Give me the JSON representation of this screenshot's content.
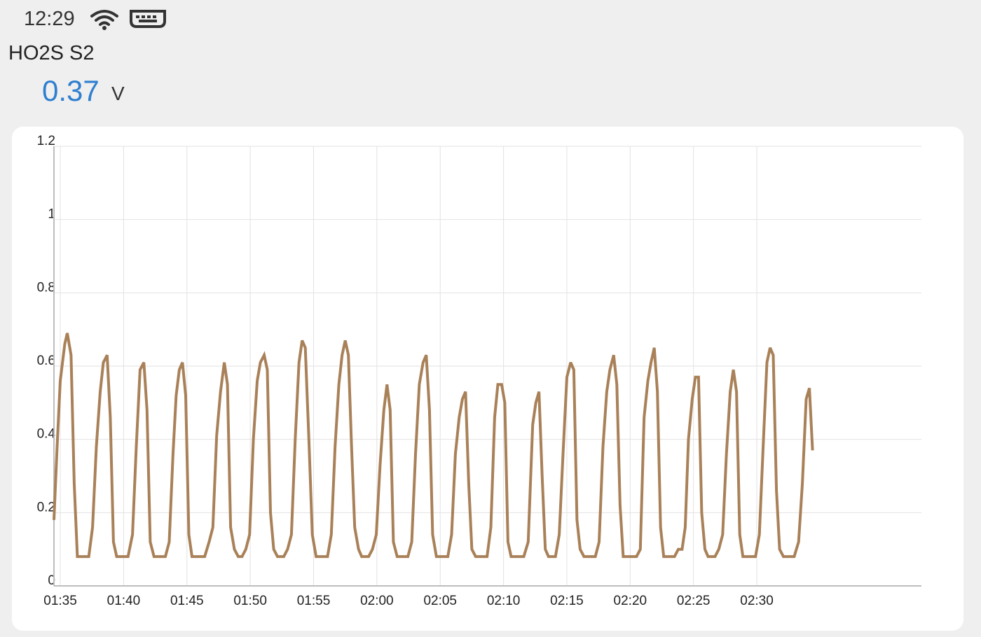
{
  "status_bar": {
    "time": "12:29",
    "icons": [
      "wifi-icon",
      "keyboard-icon"
    ]
  },
  "sensor": {
    "name": "HO2S S2",
    "value": "0.37",
    "unit": "V"
  },
  "colors": {
    "value": "#2f7fd0",
    "line": "#a98159",
    "grid": "#e2e2e2",
    "axis": "#bdbdbd",
    "card": "#ffffff",
    "background": "#efefef"
  },
  "chart_data": {
    "type": "line",
    "title": "",
    "xlabel": "",
    "ylabel": "",
    "ylim": [
      0,
      1.2
    ],
    "xlim": [
      0,
      137
    ],
    "grid": true,
    "y_ticks": [
      {
        "value": 0,
        "label": "0"
      },
      {
        "value": 0.2,
        "label": "0.2"
      },
      {
        "value": 0.4,
        "label": "0.4"
      },
      {
        "value": 0.6,
        "label": "0.6"
      },
      {
        "value": 0.8,
        "label": "0.8"
      },
      {
        "value": 1.0,
        "label": "1"
      },
      {
        "value": 1.2,
        "label": "1.2"
      }
    ],
    "x_ticks": [
      {
        "value": 1,
        "label": "01:35"
      },
      {
        "value": 11,
        "label": "01:40"
      },
      {
        "value": 21,
        "label": "01:45"
      },
      {
        "value": 31,
        "label": "01:50"
      },
      {
        "value": 41,
        "label": "01:55"
      },
      {
        "value": 51,
        "label": "02:00"
      },
      {
        "value": 61,
        "label": "02:05"
      },
      {
        "value": 71,
        "label": "02:10"
      },
      {
        "value": 81,
        "label": "02:15"
      },
      {
        "value": 91,
        "label": "02:20"
      },
      {
        "value": 101,
        "label": "02:25"
      },
      {
        "value": 111,
        "label": "02:30"
      }
    ],
    "series": [
      {
        "values": [
          [
            0,
            0.18
          ],
          [
            0.5,
            0.38
          ],
          [
            1,
            0.56
          ],
          [
            1.7,
            0.66
          ],
          [
            2.1,
            0.69
          ],
          [
            2.7,
            0.63
          ],
          [
            3.2,
            0.28
          ],
          [
            3.7,
            0.08
          ],
          [
            5.5,
            0.08
          ],
          [
            6.1,
            0.16
          ],
          [
            6.7,
            0.38
          ],
          [
            7.3,
            0.53
          ],
          [
            7.8,
            0.61
          ],
          [
            8.4,
            0.63
          ],
          [
            8.9,
            0.46
          ],
          [
            9.4,
            0.12
          ],
          [
            9.9,
            0.08
          ],
          [
            11.7,
            0.08
          ],
          [
            12.4,
            0.14
          ],
          [
            13.0,
            0.38
          ],
          [
            13.6,
            0.59
          ],
          [
            14.2,
            0.61
          ],
          [
            14.7,
            0.48
          ],
          [
            15.2,
            0.12
          ],
          [
            15.8,
            0.08
          ],
          [
            17.6,
            0.08
          ],
          [
            18.2,
            0.12
          ],
          [
            18.8,
            0.36
          ],
          [
            19.3,
            0.52
          ],
          [
            19.8,
            0.59
          ],
          [
            20.3,
            0.61
          ],
          [
            20.8,
            0.52
          ],
          [
            21.3,
            0.14
          ],
          [
            21.8,
            0.08
          ],
          [
            23.8,
            0.08
          ],
          [
            24.5,
            0.12
          ],
          [
            25.1,
            0.16
          ],
          [
            25.7,
            0.41
          ],
          [
            26.3,
            0.53
          ],
          [
            26.9,
            0.61
          ],
          [
            27.4,
            0.55
          ],
          [
            27.9,
            0.16
          ],
          [
            28.5,
            0.1
          ],
          [
            29.1,
            0.08
          ],
          [
            29.7,
            0.08
          ],
          [
            30.3,
            0.1
          ],
          [
            30.9,
            0.14
          ],
          [
            31.5,
            0.4
          ],
          [
            32.1,
            0.56
          ],
          [
            32.6,
            0.61
          ],
          [
            33.2,
            0.63
          ],
          [
            33.7,
            0.59
          ],
          [
            34.2,
            0.2
          ],
          [
            34.7,
            0.1
          ],
          [
            35.3,
            0.08
          ],
          [
            36.3,
            0.08
          ],
          [
            36.9,
            0.1
          ],
          [
            37.5,
            0.14
          ],
          [
            38.1,
            0.4
          ],
          [
            38.7,
            0.61
          ],
          [
            39.2,
            0.67
          ],
          [
            39.7,
            0.65
          ],
          [
            40.3,
            0.38
          ],
          [
            40.8,
            0.14
          ],
          [
            41.4,
            0.08
          ],
          [
            43.2,
            0.08
          ],
          [
            43.8,
            0.14
          ],
          [
            44.4,
            0.38
          ],
          [
            45.0,
            0.55
          ],
          [
            45.5,
            0.63
          ],
          [
            46.0,
            0.67
          ],
          [
            46.5,
            0.63
          ],
          [
            47.0,
            0.38
          ],
          [
            47.5,
            0.16
          ],
          [
            48.1,
            0.1
          ],
          [
            48.6,
            0.08
          ],
          [
            49.7,
            0.08
          ],
          [
            50.3,
            0.1
          ],
          [
            50.9,
            0.14
          ],
          [
            51.5,
            0.33
          ],
          [
            52.1,
            0.48
          ],
          [
            52.6,
            0.55
          ],
          [
            53.1,
            0.48
          ],
          [
            53.6,
            0.12
          ],
          [
            54.2,
            0.08
          ],
          [
            55.9,
            0.08
          ],
          [
            56.5,
            0.12
          ],
          [
            57.1,
            0.36
          ],
          [
            57.7,
            0.55
          ],
          [
            58.3,
            0.61
          ],
          [
            58.8,
            0.63
          ],
          [
            59.3,
            0.48
          ],
          [
            59.8,
            0.14
          ],
          [
            60.4,
            0.08
          ],
          [
            62.2,
            0.08
          ],
          [
            62.8,
            0.14
          ],
          [
            63.4,
            0.36
          ],
          [
            64.0,
            0.46
          ],
          [
            64.5,
            0.51
          ],
          [
            65.0,
            0.53
          ],
          [
            65.5,
            0.28
          ],
          [
            66.0,
            0.1
          ],
          [
            66.6,
            0.08
          ],
          [
            68.4,
            0.08
          ],
          [
            69.0,
            0.16
          ],
          [
            69.6,
            0.46
          ],
          [
            70.1,
            0.55
          ],
          [
            70.7,
            0.55
          ],
          [
            71.2,
            0.5
          ],
          [
            71.7,
            0.12
          ],
          [
            72.2,
            0.08
          ],
          [
            74.2,
            0.08
          ],
          [
            74.9,
            0.12
          ],
          [
            75.6,
            0.44
          ],
          [
            76.1,
            0.5
          ],
          [
            76.6,
            0.53
          ],
          [
            77.1,
            0.3
          ],
          [
            77.6,
            0.1
          ],
          [
            78.1,
            0.08
          ],
          [
            79.2,
            0.08
          ],
          [
            79.8,
            0.14
          ],
          [
            80.4,
            0.36
          ],
          [
            81.0,
            0.57
          ],
          [
            81.6,
            0.61
          ],
          [
            82.1,
            0.59
          ],
          [
            82.6,
            0.18
          ],
          [
            83.1,
            0.1
          ],
          [
            83.7,
            0.08
          ],
          [
            85.5,
            0.08
          ],
          [
            86.1,
            0.12
          ],
          [
            86.7,
            0.38
          ],
          [
            87.3,
            0.53
          ],
          [
            87.8,
            0.59
          ],
          [
            88.4,
            0.63
          ],
          [
            88.9,
            0.55
          ],
          [
            89.4,
            0.22
          ],
          [
            89.9,
            0.08
          ],
          [
            92.0,
            0.08
          ],
          [
            92.6,
            0.1
          ],
          [
            93.2,
            0.46
          ],
          [
            93.8,
            0.56
          ],
          [
            94.3,
            0.61
          ],
          [
            94.8,
            0.65
          ],
          [
            95.3,
            0.53
          ],
          [
            95.8,
            0.16
          ],
          [
            96.3,
            0.08
          ],
          [
            98.0,
            0.08
          ],
          [
            98.6,
            0.1
          ],
          [
            99.2,
            0.1
          ],
          [
            99.7,
            0.16
          ],
          [
            100.2,
            0.4
          ],
          [
            100.8,
            0.51
          ],
          [
            101.3,
            0.57
          ],
          [
            101.8,
            0.57
          ],
          [
            102.3,
            0.2
          ],
          [
            102.8,
            0.1
          ],
          [
            103.3,
            0.08
          ],
          [
            104.4,
            0.08
          ],
          [
            105.0,
            0.1
          ],
          [
            105.6,
            0.14
          ],
          [
            106.2,
            0.36
          ],
          [
            106.8,
            0.53
          ],
          [
            107.3,
            0.59
          ],
          [
            107.8,
            0.53
          ],
          [
            108.3,
            0.14
          ],
          [
            108.8,
            0.08
          ],
          [
            110.8,
            0.08
          ],
          [
            111.4,
            0.14
          ],
          [
            112.0,
            0.38
          ],
          [
            112.6,
            0.61
          ],
          [
            113.1,
            0.65
          ],
          [
            113.6,
            0.63
          ],
          [
            114.1,
            0.26
          ],
          [
            114.6,
            0.1
          ],
          [
            115.2,
            0.08
          ],
          [
            116.9,
            0.08
          ],
          [
            117.6,
            0.12
          ],
          [
            118.2,
            0.28
          ],
          [
            118.8,
            0.51
          ],
          [
            119.3,
            0.54
          ],
          [
            119.8,
            0.37
          ]
        ]
      }
    ]
  }
}
